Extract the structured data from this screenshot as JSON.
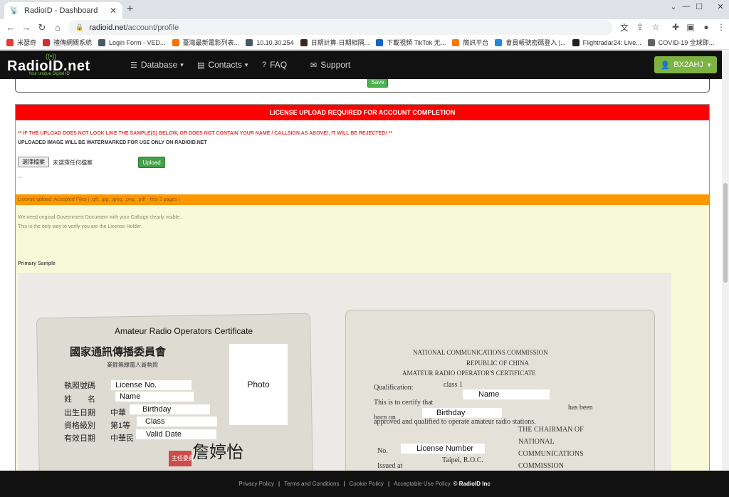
{
  "browser": {
    "tab_title": "RadioID - Dashboard",
    "url_host": "radioid.net",
    "url_path": "/account/profile",
    "bookmarks": [
      {
        "label": "米瑟奇",
        "color": "#e53935"
      },
      {
        "label": "禮傳網關系統",
        "color": "#d32f2f"
      },
      {
        "label": "Login Form - VED...",
        "color": "#455a64"
      },
      {
        "label": "臺灣最新電影列表...",
        "color": "#ff6f00"
      },
      {
        "label": "10.10.30.254",
        "color": "#455a64"
      },
      {
        "label": "日期計算-日期相隔...",
        "color": "#3e2723"
      },
      {
        "label": "下載視頻 TikTok 无...",
        "color": "#1565c0"
      },
      {
        "label": "簡訊平台",
        "color": "#f57c00"
      },
      {
        "label": "會員帳號密碼登入 |...",
        "color": "#1e88e5"
      },
      {
        "label": "Flightradar24: Live...",
        "color": "#212121"
      },
      {
        "label": "COVID-19 全球即...",
        "color": "#616161"
      }
    ]
  },
  "site": {
    "logo": "RadioID.net",
    "tagline": "Your unique Digital ID",
    "nav": {
      "database": "Database",
      "contacts": "Contacts",
      "faq": "FAQ",
      "support": "Support"
    },
    "user": "BX2AHJ"
  },
  "form": {
    "save": "Save"
  },
  "license": {
    "header": "LICENSE UPLOAD REQUIRED FOR ACCOUNT COMPLETION",
    "warning": "** IF THE UPLOAD DOES NOT LOOK LIKE THE SAMPLE(S) BELOW, OR DOES NOT CONTAIN YOUR NAME / CALLSIGN AS ABOVE!, IT WILL BE REJECTED! **",
    "note": "UPLOADED IMAGE WILL BE WATERMARKED FOR USE ONLY ON RADIOID.NET",
    "choose_file": "選擇檔案",
    "no_file": "未選擇任何檔案",
    "upload": "Upload",
    "dash": "--",
    "accepted": "License upload: Accepted Files ( .gif, .jpg, .jpeg, .png, .pdf - first 3 pages )",
    "info_1": "We need original Government Document with your Callsign clearly visible.",
    "info_2": "This is the only way to verify you are the License Holder.",
    "primary_sample": "Primary Sample"
  },
  "sample_card": {
    "title": "Amateur Radio Operators Certificate",
    "seal": "國家通訊傳播委員會",
    "sub": "業餘無線電人員執照",
    "zh_labels": [
      "執照號碼",
      "姓　　名",
      "出生日期",
      "資格級別",
      "有效日期"
    ],
    "zh_prefix_1": "中華",
    "zh_prefix_2": "第1等",
    "zh_prefix_3": "中華民",
    "license_no": "License No.",
    "name": "Name",
    "birthday": "Birthday",
    "class": "Class",
    "valid_date": "Valid Date",
    "photo": "Photo",
    "signature": "詹婷怡",
    "stamp": "主任委員",
    "eng_1": "NATIONAL COMMUNICATIONS COMMISSION",
    "eng_2": "REPUBLIC OF CHINA",
    "eng_3": "AMATEUR RADIO OPERATOR'S CERTIFICATE",
    "qualification": "Qualification:",
    "class_1": "class 1",
    "certify": "This is to certify that",
    "name_r": "Name",
    "born_on": "born on",
    "birthday_r": "Birthday",
    "has_been": "has been",
    "approved": "approved and qualified to operate amateur radio stations.",
    "chairman": "THE CHAIRMAN OF",
    "national": "NATIONAL",
    "communications": "COMMUNICATIONS",
    "commission": "COMMISSION",
    "no": "No.",
    "license_number": "License Number",
    "issued_at": "Issued at",
    "taipei": "Taipei, R.O.C."
  },
  "footer": {
    "privacy": "Privacy Policy",
    "terms": "Terms and Conditions",
    "cookie": "Cookie Policy",
    "aup": "Acceptable Use Policy",
    "copyright": "© RadioID Inc"
  }
}
